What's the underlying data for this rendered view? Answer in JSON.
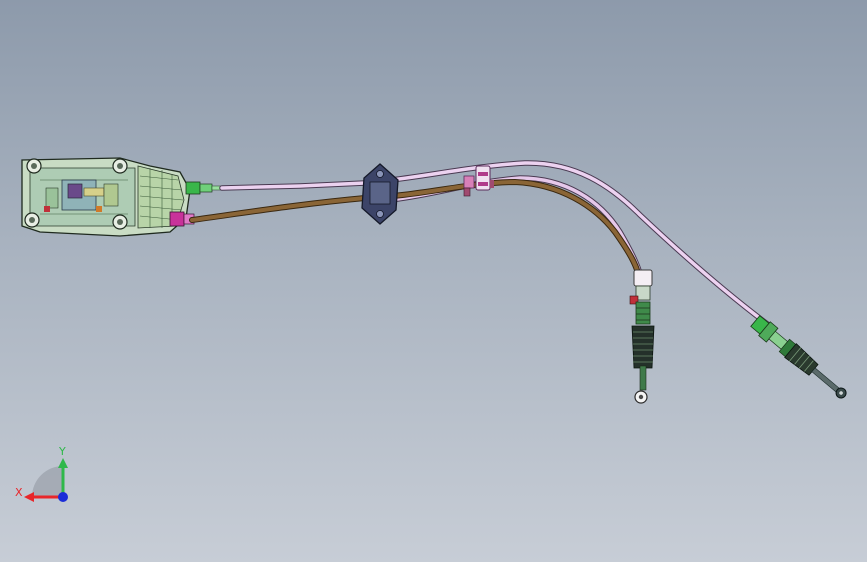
{
  "viewport": {
    "background_top": "#8d9aab",
    "background_bottom": "#c7cdd6"
  },
  "colors": {
    "shift_cable": "#e6c8ea",
    "select_cable": "#8a6536",
    "housing": "#c9dcc4",
    "green_fitting": "#39b64a",
    "magenta_fitting": "#c8329a",
    "grommet": "#3c4468"
  },
  "triad": {
    "x_label": "X",
    "y_label": "Y",
    "x_color": "#e8262a",
    "y_color": "#2fb84a",
    "z_color": "#1a2cd8"
  }
}
